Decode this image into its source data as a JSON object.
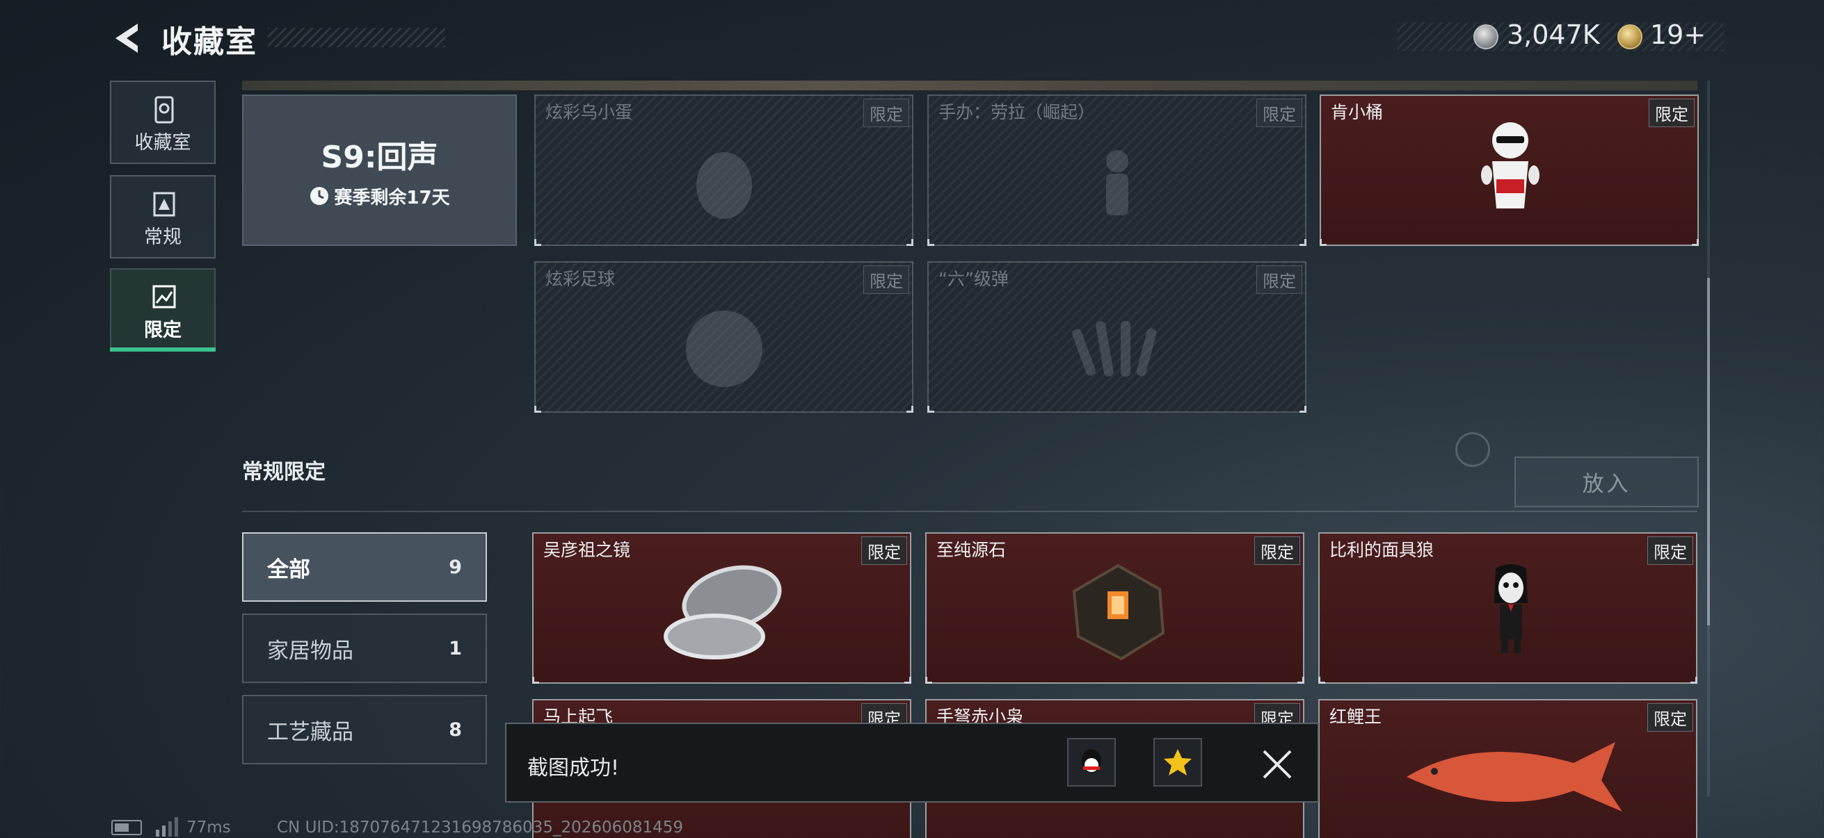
{
  "header": {
    "title": "收藏室",
    "currency_silver": "3,047K",
    "currency_gold": "19+"
  },
  "nav": [
    {
      "label": "收藏室",
      "icon": "collection-room-icon"
    },
    {
      "label": "常规",
      "icon": "regular-icon"
    },
    {
      "label": "限定",
      "icon": "limited-icon",
      "active": true
    }
  ],
  "season": {
    "title": "S9:回声",
    "remaining": "赛季剩余17天"
  },
  "season_items": [
    {
      "name": "炫彩乌小蛋",
      "tag": "限定",
      "owned": false
    },
    {
      "name": "手办：劳拉（崛起）",
      "tag": "限定",
      "owned": false
    },
    {
      "name": "肯小桶",
      "tag": "限定",
      "owned": true
    },
    {
      "name": "炫彩足球",
      "tag": "限定",
      "owned": false
    },
    {
      "name": "“六”级弹",
      "tag": "限定",
      "owned": false
    }
  ],
  "regular_section": {
    "title": "常规限定",
    "put_button": "放入"
  },
  "filters": [
    {
      "label": "全部",
      "count": "9",
      "active": true
    },
    {
      "label": "家居物品",
      "count": "1"
    },
    {
      "label": "工艺藏品",
      "count": "8"
    }
  ],
  "regular_items": [
    {
      "name": "吴彦祖之镜",
      "tag": "限定"
    },
    {
      "name": "至纯源石",
      "tag": "限定"
    },
    {
      "name": "比利的面具狼",
      "tag": "限定"
    },
    {
      "name": "马上起飞",
      "tag": "限定"
    },
    {
      "name": "手弩赤小枭",
      "tag": "限定"
    },
    {
      "name": "红鲤王",
      "tag": "限定"
    }
  ],
  "toast": {
    "message": "截图成功!"
  },
  "footer": {
    "ping": "77ms",
    "uid": "CN UID:18707647123169878603​5_202606081459"
  }
}
